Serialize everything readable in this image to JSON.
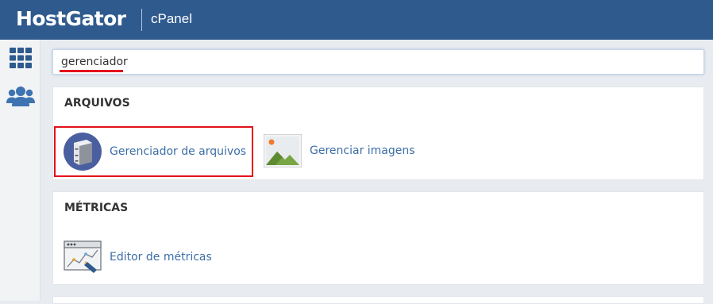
{
  "header": {
    "logo_text": "HostGator",
    "product_name": "cPanel",
    "background_color": "#2e5a8e"
  },
  "sidebar": {
    "items": [
      {
        "icon": "grid-icon",
        "label": ""
      },
      {
        "icon": "users-icon",
        "label": ""
      }
    ]
  },
  "search": {
    "value": "gerenciador",
    "placeholder": ""
  },
  "sections": [
    {
      "title": "ARQUIVOS",
      "items": [
        {
          "label": "Gerenciador de arquivos",
          "icon": "file-cabinet-icon",
          "highlighted": true
        },
        {
          "label": "Gerenciar imagens",
          "icon": "image-icon",
          "highlighted": false
        }
      ]
    },
    {
      "title": "MÉTRICAS",
      "items": [
        {
          "label": "Editor de métricas",
          "icon": "metrics-editor-icon",
          "highlighted": false
        }
      ]
    }
  ],
  "colors": {
    "accent_red": "#e3121c",
    "link_blue": "#3c6ea6"
  }
}
